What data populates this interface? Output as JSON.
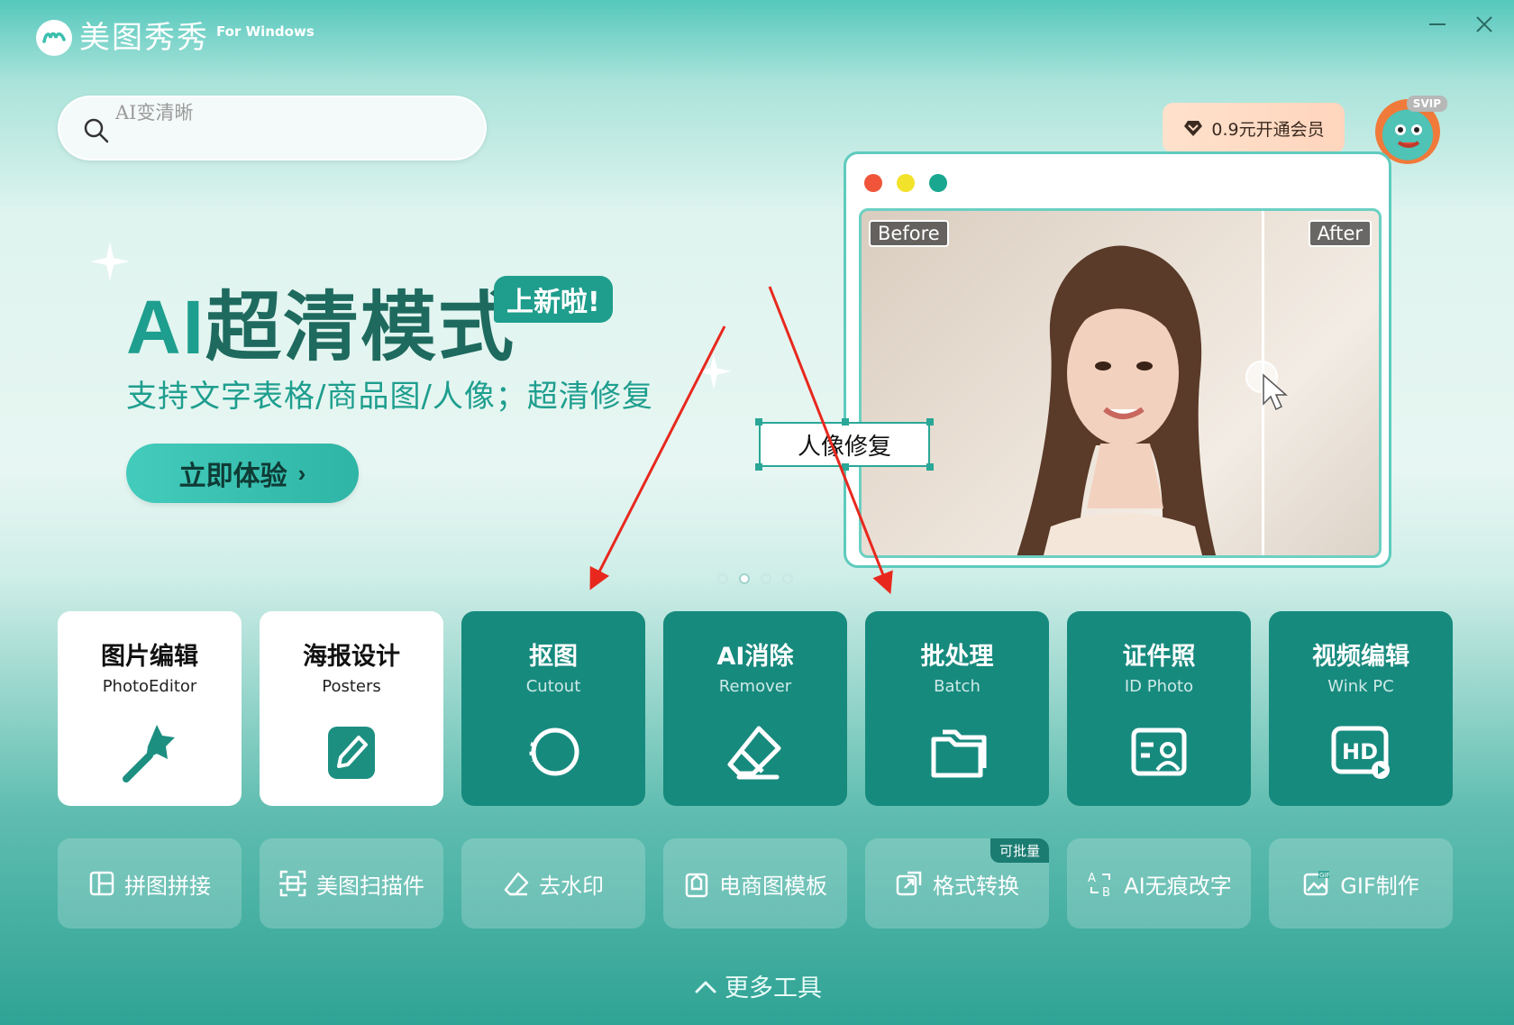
{
  "app": {
    "name": "美图秀秀",
    "platform": "For Windows"
  },
  "search": {
    "placeholder": "AI变清晰"
  },
  "vip": {
    "label": "0.9元开通会员",
    "avatar_badge": "SVIP"
  },
  "banner": {
    "headline_ai": "AI",
    "headline_rest": "超清模式",
    "new_badge": "上新啦!",
    "subline": "支持文字表格/商品图/人像；超清修复",
    "cta_label": "立即体验",
    "before_label": "Before",
    "after_label": "After",
    "tag_label": "人像修复",
    "page_count": 4,
    "active_page": 2
  },
  "tools": [
    {
      "title": "图片编辑",
      "subtitle": "PhotoEditor",
      "style": "light",
      "icon": "magic-wand-icon"
    },
    {
      "title": "海报设计",
      "subtitle": "Posters",
      "style": "light",
      "icon": "pencil-edit-icon"
    },
    {
      "title": "抠图",
      "subtitle": "Cutout",
      "style": "dark",
      "icon": "lasso-circle-icon"
    },
    {
      "title": "AI消除",
      "subtitle": "Remover",
      "style": "dark",
      "icon": "eraser-icon"
    },
    {
      "title": "批处理",
      "subtitle": "Batch",
      "style": "dark",
      "icon": "folder-icon"
    },
    {
      "title": "证件照",
      "subtitle": "ID Photo",
      "style": "dark",
      "icon": "id-card-icon"
    },
    {
      "title": "视频编辑",
      "subtitle": "Wink PC",
      "style": "dark",
      "icon": "hd-video-icon"
    }
  ],
  "mini_tools": [
    {
      "label": "拼图拼接",
      "icon": "collage-icon"
    },
    {
      "label": "美图扫描件",
      "icon": "scan-icon"
    },
    {
      "label": "去水印",
      "icon": "eraser-small-icon"
    },
    {
      "label": "电商图模板",
      "icon": "shopping-bag-icon"
    },
    {
      "label": "格式转换",
      "icon": "convert-icon",
      "badge": "可批量"
    },
    {
      "label": "AI无痕改字",
      "icon": "text-replace-icon"
    },
    {
      "label": "GIF制作",
      "icon": "gif-icon"
    }
  ],
  "more_tools": {
    "label": "更多工具"
  },
  "colors": {
    "brand_dark": "#178a7e",
    "brand_accent": "#1e9e8e",
    "vip_bg": "#ffd9c2",
    "dot_red": "#f0553a",
    "dot_yellow": "#f3e22a",
    "dot_green": "#19a88f"
  }
}
